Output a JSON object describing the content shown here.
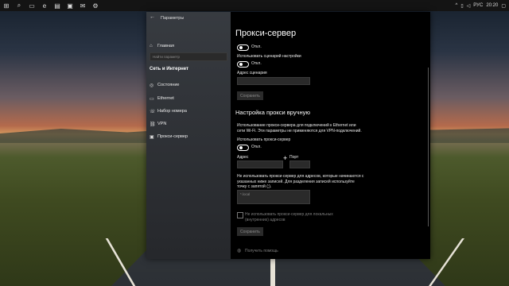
{
  "window": {
    "title": "Параметры"
  },
  "sidebar": {
    "home": "Главная",
    "search_placeholder": "Найти параметр",
    "section": "Сеть и Интернет",
    "items": [
      {
        "label": "Состояние",
        "icon": "globe-icon"
      },
      {
        "label": "Ethernet",
        "icon": "ethernet-icon"
      },
      {
        "label": "Набор номера",
        "icon": "dialup-icon"
      },
      {
        "label": "VPN",
        "icon": "vpn-icon"
      },
      {
        "label": "Прокси-сервер",
        "icon": "proxy-icon"
      }
    ]
  },
  "content": {
    "title": "Прокси-сервер",
    "toggle1_state": "Откл.",
    "use_script_label": "Использовать сценарий настройки",
    "toggle2_state": "Откл.",
    "script_address_label": "Адрес сценария",
    "save1": "Сохранить",
    "manual_heading": "Настройка прокси вручную",
    "manual_desc": "Использование прокси-сервера для подключений к Ethernet или сети Wi-Fi. Эти параметры не применяются для VPN-подключений.",
    "use_proxy_label": "Использовать прокси-сервер",
    "toggle3_state": "Откл.",
    "address_label": "Адрес",
    "port_label": "Порт",
    "exceptions_desc": "Не использовать прокси-сервер для адресов, которые начинаются с указанных ниже записей. Для разделения записей используйте точку с запятой (;).",
    "exceptions_placeholder": "*.local",
    "local_checkbox_label": "Не использовать прокси-сервер для локальных (внутренних) адресов",
    "save2": "Сохранить",
    "help_link": "Получить помощь"
  },
  "taskbar": {
    "lang": "РУС",
    "time": "20:20"
  },
  "colors": {
    "window_bg": "#000000",
    "sidebar_bg": "#3c4046",
    "field_bg": "#2a2a2a"
  }
}
